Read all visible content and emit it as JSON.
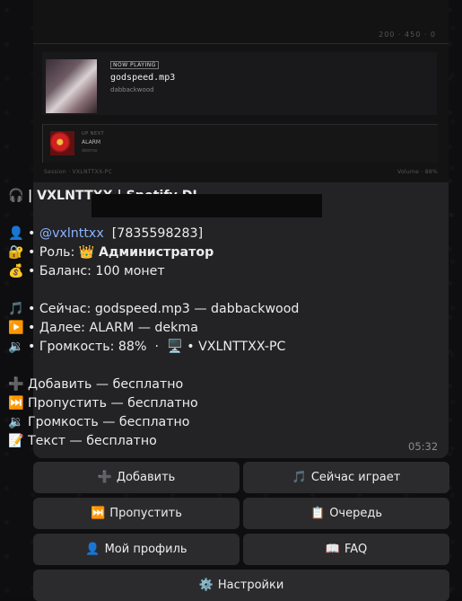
{
  "preview": {
    "corner_text": "200 · 450 · 0",
    "now_playing_badge": "NOW PLAYING",
    "track_title": "godspeed.mp3",
    "track_artist": "dabbackwood",
    "up_next_label": "UP NEXT",
    "next_title": "ALARM",
    "next_artist": "dekma",
    "footer_left": "Session  ·  VXLNTTXX-PC",
    "footer_right": "Volume  ·  88%"
  },
  "message": {
    "header": "| VXLNTTXX | Spotify DJ",
    "user_mention": "@vxlnttxx",
    "user_id": "[7835598283]",
    "role_label": "• Роль:",
    "role_value": "Администратор",
    "balance": "• Баланс: 100 монет",
    "now_label": "• Сейчас:",
    "now_value": "godspeed.mp3 — dabbackwood",
    "next_label": "• Далее:",
    "next_value": "ALARM — dekma",
    "volume_label": "• Громкость:",
    "volume_value": "88%",
    "device_value": "VXLNTTXX-PC",
    "price_add": "Добавить — бесплатно",
    "price_skip": "Пропустить — бесплатно",
    "price_volume": "Громкость — бесплатно",
    "price_lyrics": "Текст — бесплатно",
    "time": "05:32"
  },
  "icons": {
    "headphones": "🎧",
    "user": "👤",
    "lock": "🔐",
    "crown": "👑",
    "moneybag": "💰",
    "music": "🎵",
    "play": "▶️",
    "speaker": "🔉",
    "computer": "🖥️",
    "plus": "➕",
    "skip": "⏭️",
    "memo": "📝",
    "clipboard": "📋",
    "book": "📖",
    "gear": "⚙️"
  },
  "keyboard": {
    "add": "Добавить",
    "now_playing": "Сейчас играет",
    "skip": "Пропустить",
    "queue": "Очередь",
    "profile": "Мой профиль",
    "faq": "FAQ",
    "settings": "Настройки"
  }
}
